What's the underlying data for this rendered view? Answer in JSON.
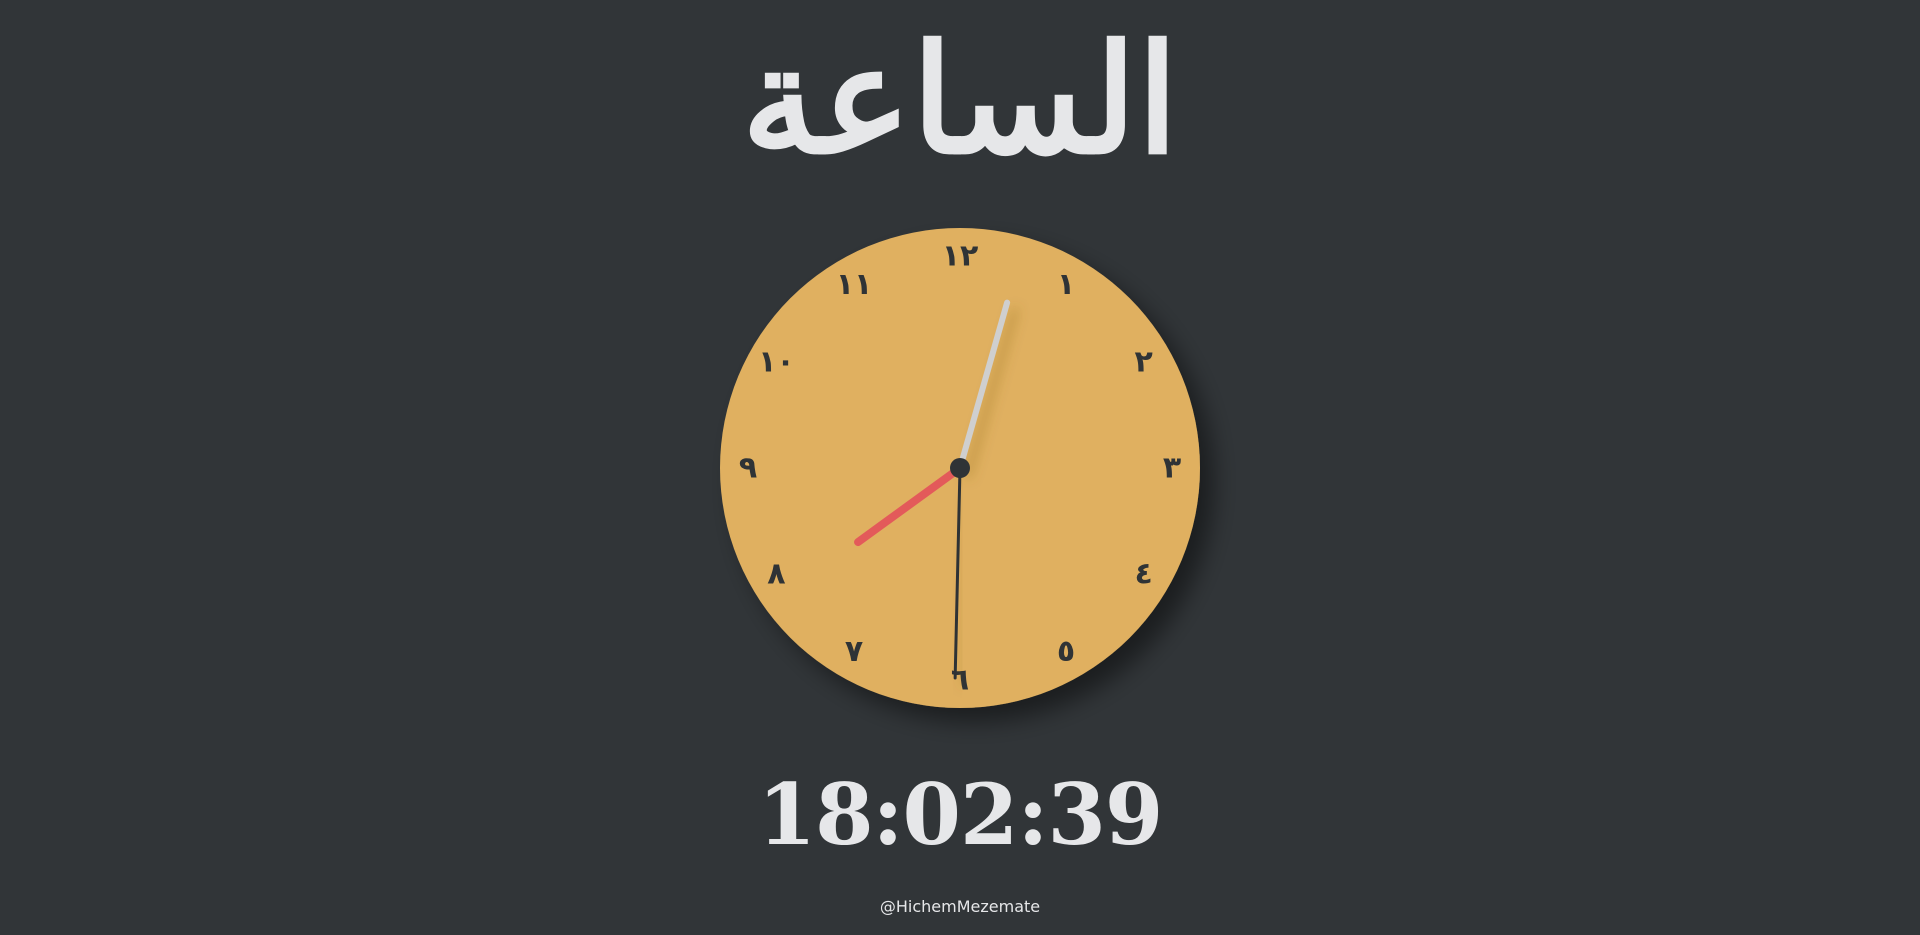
{
  "header": {
    "title": "الساعة"
  },
  "clock": {
    "numerals": [
      "١٢",
      "١",
      "٢",
      "٣",
      "٤",
      "٥",
      "٦",
      "٧",
      "٨",
      "٩",
      "١٠",
      "١١"
    ],
    "time": {
      "hours": 18,
      "minutes": 2,
      "seconds": 39
    },
    "colors": {
      "face": "#e0b060",
      "numerals": "#2f3336",
      "hour_hand": "#2f3336",
      "minute_hand": "#cfcfcf",
      "second_hand": "#e35a5a",
      "center": "#2f3336"
    }
  },
  "digital": {
    "display": "18:02:39"
  },
  "footer": {
    "credit": "@HichemMezemate"
  }
}
